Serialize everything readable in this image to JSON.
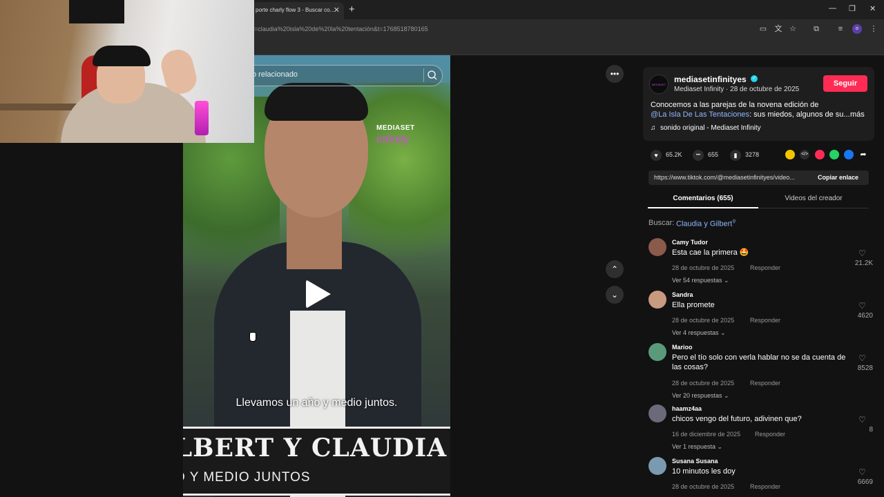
{
  "browser": {
    "tab_title": "porte charly flow 3 - Buscar co...",
    "tab_close": "✕",
    "new_tab": "+",
    "url": "=claudia%20isla%20de%20la%20tentación&t=1768518780165",
    "win_min": "—",
    "win_restore": "❐",
    "win_close": "✕",
    "profile_initial": "o"
  },
  "video": {
    "search_text": "o relacionado",
    "logo_top": "MEDIASET",
    "logo_bottom": "infinity",
    "subtitle": "Llevamos un año y medio juntos.",
    "banner_title": "ILBERT Y CLAUDIA",
    "banner_sub": "O Y MEDIO JUNTOS"
  },
  "side": {
    "more": "•••",
    "up": "⌃",
    "down": "⌄"
  },
  "post": {
    "avatar_text": "MEDIASET",
    "username": "mediasetinfinityes",
    "verified": "✓",
    "subinfo": "Mediaset Infinity · 28 de octubre de 2025",
    "follow": "Seguir",
    "desc_line1": "Conocemos a las parejas de la novena edición de",
    "desc_link": "@La Isla De Las Tentaciones",
    "desc_rest": ": sus miedos, algunos de su...",
    "more": "más",
    "sound_icon": "♫",
    "sound": "sonido original - Mediaset Infinity"
  },
  "stats": {
    "likes": "65.2K",
    "comments": "655",
    "saves": "3278",
    "like_icon": "♥",
    "comment_icon": "•••",
    "save_icon": "▮"
  },
  "share": {
    "embed": "</>",
    "arrow": "➦"
  },
  "share_colors": [
    "#f5c400",
    "#2b2b2b",
    "#fe2c55",
    "#25d366",
    "#1877f2"
  ],
  "link": {
    "url": "https://www.tiktok.com/@mediasetinfinityes/video...",
    "copy": "Copiar enlace"
  },
  "tabs": {
    "comments": "Comentarios (655)",
    "videos": "Videos del creador"
  },
  "search": {
    "label": "Buscar:",
    "term": "Claudia y Gilbert"
  },
  "comments": [
    {
      "user": "Camy Tudor",
      "text": "Esta cae la primera 🤩",
      "date": "28 de octubre de 2025",
      "reply": "Responder",
      "more": "Ver 54 respuestas ⌄",
      "likes": "21.2K",
      "avatar_color": "#8a5a4a"
    },
    {
      "user": "Sandra",
      "text": "Ella promete",
      "date": "28 de octubre de 2025",
      "reply": "Responder",
      "more": "Ver 4 respuestas ⌄",
      "likes": "4620",
      "avatar_color": "#c89a80"
    },
    {
      "user": "Marioo",
      "text": "Pero el tío solo con verla hablar no se da cuenta de las cosas?",
      "date": "28 de octubre de 2025",
      "reply": "Responder",
      "more": "Ver 20 respuestas ⌄",
      "likes": "8528",
      "avatar_color": "#5a9a7a"
    },
    {
      "user": "haamz4aa",
      "text": "chicos vengo del futuro, adivinen que?",
      "date": "16 de diciembre de 2025",
      "reply": "Responder",
      "more": "Ver 1 respuesta ⌄",
      "likes": "8",
      "avatar_color": "#6a6a7a"
    },
    {
      "user": "Susana Susana",
      "text": "10 minutos les doy",
      "date": "28 de octubre de 2025",
      "reply": "Responder",
      "more": "",
      "likes": "6669",
      "avatar_color": "#7a9ab0"
    }
  ],
  "heart_icon": "♡"
}
